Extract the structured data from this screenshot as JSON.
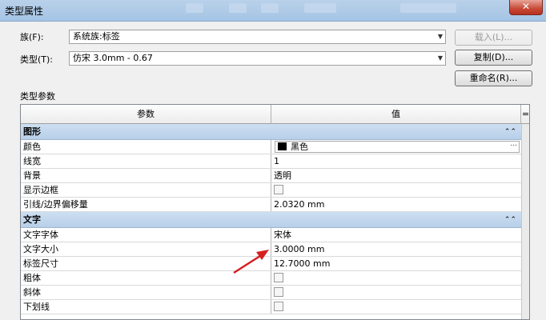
{
  "window": {
    "title": "类型属性",
    "close_glyph": "✕"
  },
  "family": {
    "label": "族(F):",
    "value": "系统族:标签"
  },
  "type": {
    "label": "类型(T):",
    "value": "仿宋 3.0mm - 0.67"
  },
  "buttons": {
    "load": "载入(L)...",
    "duplicate": "复制(D)...",
    "rename": "重命名(R)..."
  },
  "section_label": "类型参数",
  "table": {
    "col_param": "参数",
    "col_value": "值",
    "col_extra": "=",
    "groups": [
      {
        "title": "图形",
        "collapse": "≈",
        "rows": [
          {
            "param": "颜色",
            "value": "黑色",
            "kind": "color"
          },
          {
            "param": "线宽",
            "value": "1",
            "kind": "text"
          },
          {
            "param": "背景",
            "value": "透明",
            "kind": "text"
          },
          {
            "param": "显示边框",
            "value": "",
            "kind": "checkbox"
          },
          {
            "param": "引线/边界偏移量",
            "value": "2.0320 mm",
            "kind": "text"
          }
        ]
      },
      {
        "title": "文字",
        "collapse": "≈",
        "rows": [
          {
            "param": "文字字体",
            "value": "宋体",
            "kind": "text"
          },
          {
            "param": "文字大小",
            "value": "3.0000 mm",
            "kind": "text"
          },
          {
            "param": "标签尺寸",
            "value": "12.7000 mm",
            "kind": "text"
          },
          {
            "param": "粗体",
            "value": "",
            "kind": "checkbox"
          },
          {
            "param": "斜体",
            "value": "",
            "kind": "checkbox"
          },
          {
            "param": "下划线",
            "value": "",
            "kind": "checkbox"
          }
        ]
      }
    ]
  },
  "colors": {
    "annotation_arrow": "#d42020",
    "group_bg": "#c4d8ee"
  }
}
